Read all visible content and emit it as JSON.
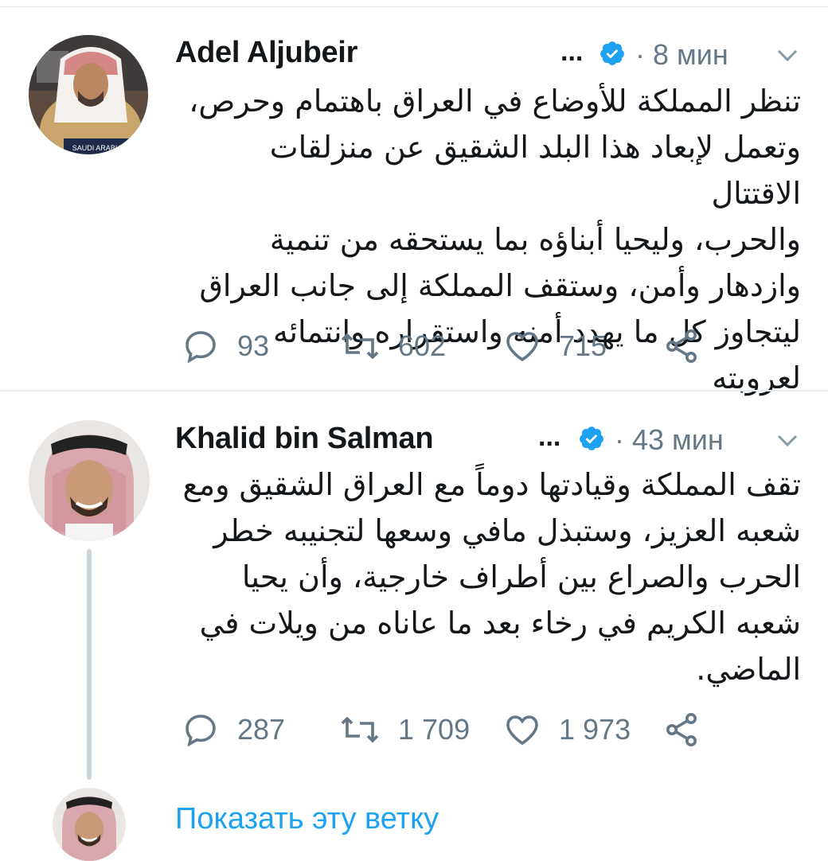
{
  "tweets": [
    {
      "name": "Adel Aljubeir",
      "ellipsis": "...",
      "time": "· 8 мин",
      "lines": [
        "تنظر المملكة للأوضاع في العراق باهتمام وحرص،",
        "وتعمل لإبعاد هذا البلد الشقيق عن منزلقات الاقتتال",
        "والحرب، وليحيا أبناؤه بما يستحقه من تنمية",
        "وازدهار وأمن، وستقف المملكة إلى جانب العراق",
        "ليتجاوز كل ما يهدد أمنه واستقراره وانتمائه لعروبته"
      ],
      "replies": "93",
      "retweets": "602",
      "likes": "715",
      "avatar_placard": "SAUDI ARABIA"
    },
    {
      "name": "Khalid bin Salman",
      "ellipsis": "...",
      "time": "· 43 мин",
      "lines": [
        "تقف المملكة وقيادتها دوماً مع العراق الشقيق ومع",
        "شعبه العزيز، وستبذل مافي وسعها لتجنيبه خطر",
        "الحرب والصراع بين أطراف خارجية، وأن يحيا",
        "شعبه الكريم في رخاء بعد ما عاناه من ويلات في",
        "الماضي."
      ],
      "replies": "287",
      "retweets": "1 709",
      "likes": "1 973"
    }
  ],
  "show_thread": "Показать эту ветку",
  "colors": {
    "text": "#14171a",
    "secondary": "#657786",
    "link": "#1da1f2",
    "verified": "#1da1f2"
  },
  "icons": [
    "reply-icon",
    "retweet-icon",
    "like-icon",
    "share-icon",
    "verified-badge-icon",
    "chevron-down-icon"
  ]
}
